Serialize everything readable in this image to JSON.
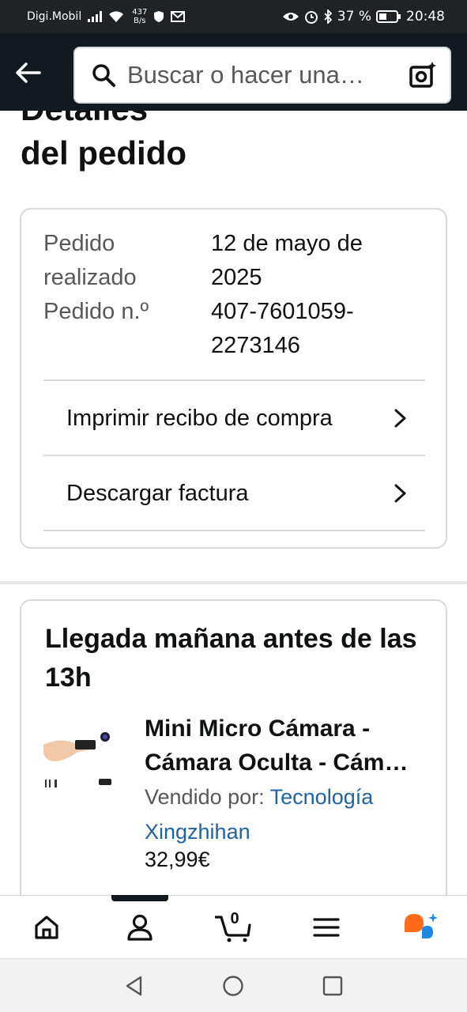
{
  "status_bar": {
    "carrier": "Digi.Mobil",
    "net_speed_value": "437",
    "net_speed_unit": "B/s",
    "battery": "37 %",
    "time": "20:48"
  },
  "search": {
    "placeholder": "Buscar o hacer una…"
  },
  "page": {
    "title_line1": "Detalles",
    "title_line2": "del pedido"
  },
  "order": {
    "placed_label_1": "Pedido",
    "placed_label_2": "realizado",
    "placed_value_1": "12 de mayo de",
    "placed_value_2": "2025",
    "number_label": "Pedido n.º",
    "number_value_1": "407-7601059-",
    "number_value_2": "2273146",
    "links": [
      {
        "label": "Imprimir recibo de compra"
      },
      {
        "label": "Descargar factura"
      }
    ]
  },
  "shipment": {
    "title": "Llegada mañana antes de las 13h",
    "product": {
      "name_line1": "Mini Micro Cámara -",
      "name_line2": "Cámara Oculta - Cám…",
      "sold_by_label": "Vendido por: ",
      "seller_line1": "Tecnología",
      "seller_line2": "Xingzhihan",
      "price": "32,99€"
    }
  },
  "bottom_nav": {
    "items": [
      "home-icon",
      "account-icon",
      "cart-icon",
      "menu-icon",
      "rufus-icon"
    ],
    "cart_count": "0",
    "active": "account-icon"
  },
  "colors": {
    "header_bg": "#131921",
    "link": "#2162A1",
    "rufus_orange": "#FF6B1A",
    "rufus_blue": "#1E88E5"
  }
}
